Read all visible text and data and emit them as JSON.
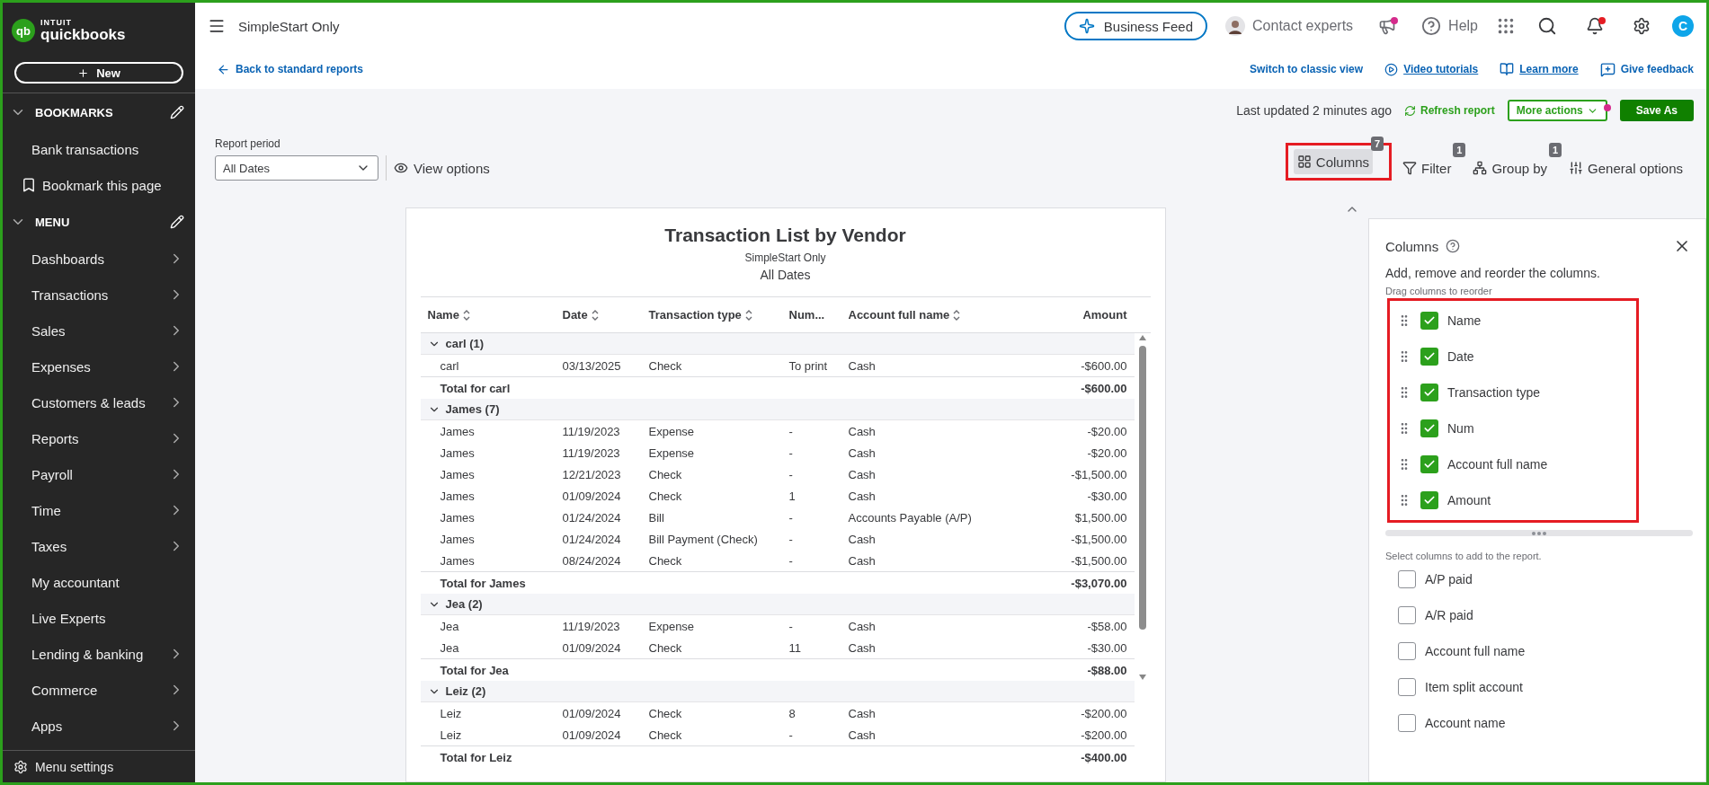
{
  "sidebar": {
    "logo_mark": "qb",
    "brand_top": "INTUIT",
    "brand": "quickbooks",
    "new_button": "New",
    "sections": [
      {
        "title": "BOOKMARKS",
        "expanded": true,
        "items": [
          {
            "label": "Bank transactions",
            "kind": "link",
            "has_submenu": false
          },
          {
            "label": "Bookmark this page",
            "kind": "bookmark",
            "has_submenu": false
          }
        ]
      },
      {
        "title": "MENU",
        "expanded": true,
        "items": [
          {
            "label": "Dashboards",
            "kind": "link",
            "has_submenu": true
          },
          {
            "label": "Transactions",
            "kind": "link",
            "has_submenu": true
          },
          {
            "label": "Sales",
            "kind": "link",
            "has_submenu": true
          },
          {
            "label": "Expenses",
            "kind": "link",
            "has_submenu": true
          },
          {
            "label": "Customers & leads",
            "kind": "link",
            "has_submenu": true
          },
          {
            "label": "Reports",
            "kind": "link",
            "has_submenu": true
          },
          {
            "label": "Payroll",
            "kind": "link",
            "has_submenu": true
          },
          {
            "label": "Time",
            "kind": "link",
            "has_submenu": true
          },
          {
            "label": "Taxes",
            "kind": "link",
            "has_submenu": true
          },
          {
            "label": "My accountant",
            "kind": "link",
            "has_submenu": false
          },
          {
            "label": "Live Experts",
            "kind": "link",
            "has_submenu": false
          },
          {
            "label": "Lending & banking",
            "kind": "link",
            "has_submenu": true
          },
          {
            "label": "Commerce",
            "kind": "link",
            "has_submenu": true
          },
          {
            "label": "Apps",
            "kind": "link",
            "has_submenu": true
          }
        ]
      }
    ],
    "settings": "Menu settings"
  },
  "topbar": {
    "company": "SimpleStart Only",
    "business_feed": "Business Feed",
    "contact": "Contact experts",
    "help": "Help",
    "avatar": "C"
  },
  "links": {
    "back": "Back to standard reports",
    "right": [
      {
        "label": "Switch to classic view",
        "kind": "plain"
      },
      {
        "label": "Video tutorials",
        "kind": "video"
      },
      {
        "label": "Learn more",
        "kind": "book"
      },
      {
        "label": "Give feedback",
        "kind": "feedback"
      }
    ]
  },
  "actions": {
    "last_updated": "Last updated 2 minutes ago",
    "refresh": "Refresh report",
    "more": "More actions",
    "save": "Save As"
  },
  "report_period": {
    "label": "Report period",
    "value": "All Dates"
  },
  "view_options": "View options",
  "tools": [
    {
      "label": "Columns",
      "badge": "7",
      "kind": "columns",
      "selected": true
    },
    {
      "label": "Filter",
      "badge": "1",
      "kind": "filter",
      "selected": false
    },
    {
      "label": "Group by",
      "badge": "1",
      "kind": "group",
      "selected": false
    },
    {
      "label": "General options",
      "kind": "general",
      "selected": false
    }
  ],
  "report": {
    "title": "Transaction List by Vendor",
    "subtitle": "SimpleStart Only",
    "period": "All Dates",
    "columns": [
      {
        "label": "Name",
        "sortable": true,
        "kind": "text"
      },
      {
        "label": "Date",
        "sortable": true,
        "kind": "text"
      },
      {
        "label": "Transaction type",
        "sortable": true,
        "kind": "text"
      },
      {
        "label": "Num...",
        "sortable": false,
        "kind": "text"
      },
      {
        "label": "Account full name",
        "sortable": true,
        "kind": "text"
      },
      {
        "label": "Amount",
        "sortable": false,
        "kind": "amount"
      }
    ],
    "groups": [
      {
        "name": "carl (1)",
        "expanded": true,
        "rows": [
          [
            "carl",
            "03/13/2025",
            "Check",
            "To print",
            "Cash",
            "-$600.00"
          ]
        ],
        "total": {
          "label": "Total for carl",
          "amount": "-$600.00"
        }
      },
      {
        "name": "James (7)",
        "expanded": true,
        "rows": [
          [
            "James",
            "11/19/2023",
            "Expense",
            "-",
            "Cash",
            "-$20.00"
          ],
          [
            "James",
            "11/19/2023",
            "Expense",
            "-",
            "Cash",
            "-$20.00"
          ],
          [
            "James",
            "12/21/2023",
            "Check",
            "-",
            "Cash",
            "-$1,500.00"
          ],
          [
            "James",
            "01/09/2024",
            "Check",
            "1",
            "Cash",
            "-$30.00"
          ],
          [
            "James",
            "01/24/2024",
            "Bill",
            "-",
            "Accounts Payable (A/P)",
            "$1,500.00"
          ],
          [
            "James",
            "01/24/2024",
            "Bill Payment (Check)",
            "-",
            "Cash",
            "-$1,500.00"
          ],
          [
            "James",
            "08/24/2024",
            "Check",
            "-",
            "Cash",
            "-$1,500.00"
          ]
        ],
        "total": {
          "label": "Total for James",
          "amount": "-$3,070.00"
        }
      },
      {
        "name": "Jea (2)",
        "expanded": true,
        "rows": [
          [
            "Jea",
            "11/19/2023",
            "Expense",
            "-",
            "Cash",
            "-$58.00"
          ],
          [
            "Jea",
            "01/09/2024",
            "Check",
            "11",
            "Cash",
            "-$30.00"
          ]
        ],
        "total": {
          "label": "Total for Jea",
          "amount": "-$88.00"
        }
      },
      {
        "name": "Leiz (2)",
        "expanded": true,
        "rows": [
          [
            "Leiz",
            "01/09/2024",
            "Check",
            "8",
            "Cash",
            "-$200.00"
          ],
          [
            "Leiz",
            "01/09/2024",
            "Check",
            "-",
            "Cash",
            "-$200.00"
          ]
        ],
        "total": {
          "label": "Total for Leiz",
          "amount": "-$400.00"
        }
      }
    ]
  },
  "columns_panel": {
    "title": "Columns",
    "description": "Add, remove and reorder the columns.",
    "drag_hint": "Drag columns to reorder",
    "active": [
      {
        "label": "Name",
        "checked": true
      },
      {
        "label": "Date",
        "checked": true
      },
      {
        "label": "Transaction type",
        "checked": true
      },
      {
        "label": "Num",
        "checked": true
      },
      {
        "label": "Account full name",
        "checked": true
      },
      {
        "label": "Amount",
        "checked": true
      }
    ],
    "add_hint": "Select columns to add to the report.",
    "available": [
      {
        "label": "A/P paid",
        "checked": false
      },
      {
        "label": "A/R paid",
        "checked": false
      },
      {
        "label": "Account full name",
        "checked": false
      },
      {
        "label": "Item split account",
        "checked": false
      },
      {
        "label": "Account name",
        "checked": false
      }
    ]
  }
}
